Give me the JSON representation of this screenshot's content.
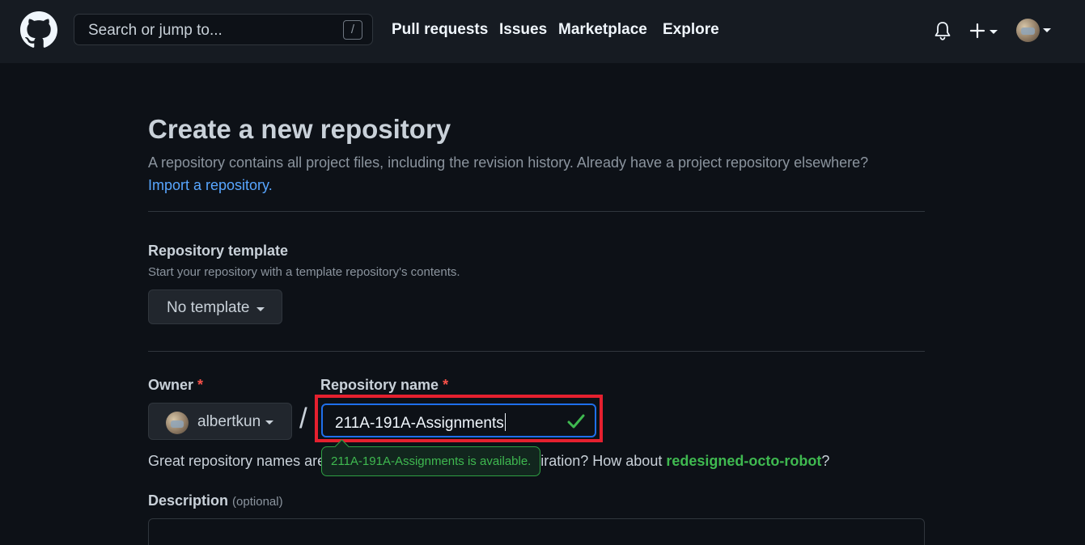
{
  "header": {
    "search_placeholder": "Search or jump to...",
    "search_shortcut": "/",
    "nav": [
      "Pull requests",
      "Issues",
      "Marketplace",
      "Explore"
    ]
  },
  "page": {
    "title": "Create a new repository",
    "subtitle": "A repository contains all project files, including the revision history. Already have a project repository elsewhere?",
    "import_link": "Import a repository."
  },
  "template": {
    "label": "Repository template",
    "hint": "Start your repository with a template repository's contents.",
    "button": "No template"
  },
  "owner": {
    "label": "Owner",
    "required_mark": "*",
    "name": "albertkun"
  },
  "repo": {
    "label": "Repository name",
    "required_mark": "*",
    "separator": "/",
    "value": "211A-191A-Assignments",
    "available_message": "211A-191A-Assignments is available.",
    "suggestion_prefix": "Great repository names are short and memorable. Need inspiration? How about",
    "suggestion": "redesigned-octo-robot",
    "suggestion_suffix": "?"
  },
  "description": {
    "label": "Description",
    "optional": "(optional)"
  },
  "colors": {
    "accent_blue": "#58a6ff",
    "success_green": "#3fb950",
    "highlight_red": "#e5202f",
    "background": "#0d1117",
    "header_bg": "#161b22"
  }
}
